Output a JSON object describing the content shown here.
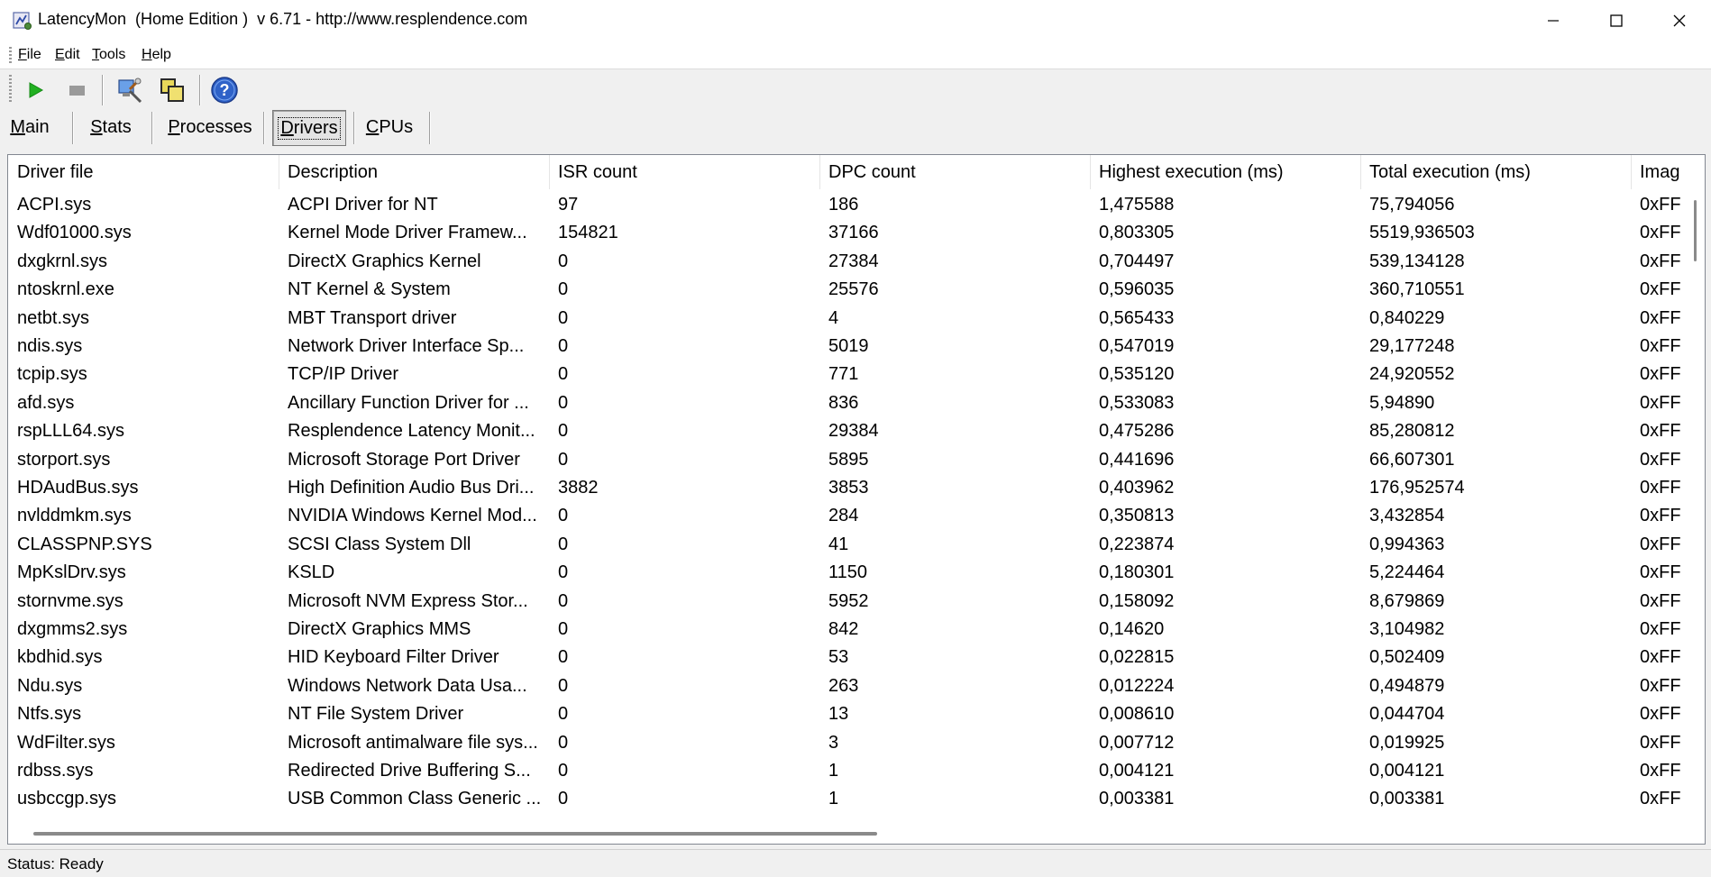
{
  "window": {
    "title": "LatencyMon  (Home Edition )  v 6.71 - http://www.resplendence.com",
    "controls": {
      "minimize": "minimize",
      "maximize": "maximize",
      "close": "close"
    }
  },
  "menu": [
    "File",
    "Edit",
    "Tools",
    "Help"
  ],
  "toolbar": {
    "buttons": [
      "play-icon",
      "stop-icon",
      "monitor-tools-icon",
      "windows-icon",
      "help-icon"
    ]
  },
  "tabs": [
    "Main",
    "Stats",
    "Processes",
    "Drivers",
    "CPUs"
  ],
  "active_tab": "Drivers",
  "table": {
    "columns": [
      "Driver file",
      "Description",
      "ISR count",
      "DPC count",
      "Highest execution (ms)",
      "Total execution (ms)",
      "Imag"
    ],
    "rows": [
      [
        "ACPI.sys",
        "ACPI Driver for NT",
        "97",
        "186",
        "1,475588",
        "75,794056",
        "0xFF"
      ],
      [
        "Wdf01000.sys",
        "Kernel Mode Driver Framew...",
        "154821",
        "37166",
        "0,803305",
        "5519,936503",
        "0xFF"
      ],
      [
        "dxgkrnl.sys",
        "DirectX Graphics Kernel",
        "0",
        "27384",
        "0,704497",
        "539,134128",
        "0xFF"
      ],
      [
        "ntoskrnl.exe",
        "NT Kernel & System",
        "0",
        "25576",
        "0,596035",
        "360,710551",
        "0xFF"
      ],
      [
        "netbt.sys",
        "MBT Transport driver",
        "0",
        "4",
        "0,565433",
        "0,840229",
        "0xFF"
      ],
      [
        "ndis.sys",
        "Network Driver Interface Sp...",
        "0",
        "5019",
        "0,547019",
        "29,177248",
        "0xFF"
      ],
      [
        "tcpip.sys",
        "TCP/IP Driver",
        "0",
        "771",
        "0,535120",
        "24,920552",
        "0xFF"
      ],
      [
        "afd.sys",
        "Ancillary Function Driver for ...",
        "0",
        "836",
        "0,533083",
        "5,94890",
        "0xFF"
      ],
      [
        "rspLLL64.sys",
        "Resplendence Latency Monit...",
        "0",
        "29384",
        "0,475286",
        "85,280812",
        "0xFF"
      ],
      [
        "storport.sys",
        "Microsoft Storage Port Driver",
        "0",
        "5895",
        "0,441696",
        "66,607301",
        "0xFF"
      ],
      [
        "HDAudBus.sys",
        "High Definition Audio Bus Dri...",
        "3882",
        "3853",
        "0,403962",
        "176,952574",
        "0xFF"
      ],
      [
        "nvlddmkm.sys",
        "NVIDIA Windows Kernel Mod...",
        "0",
        "284",
        "0,350813",
        "3,432854",
        "0xFF"
      ],
      [
        "CLASSPNP.SYS",
        "SCSI Class System Dll",
        "0",
        "41",
        "0,223874",
        "0,994363",
        "0xFF"
      ],
      [
        "MpKslDrv.sys",
        "KSLD",
        "0",
        "1150",
        "0,180301",
        "5,224464",
        "0xFF"
      ],
      [
        "stornvme.sys",
        "Microsoft NVM Express Stor...",
        "0",
        "5952",
        "0,158092",
        "8,679869",
        "0xFF"
      ],
      [
        "dxgmms2.sys",
        "DirectX Graphics MMS",
        "0",
        "842",
        "0,14620",
        "3,104982",
        "0xFF"
      ],
      [
        "kbdhid.sys",
        "HID Keyboard Filter Driver",
        "0",
        "53",
        "0,022815",
        "0,502409",
        "0xFF"
      ],
      [
        "Ndu.sys",
        "Windows Network Data Usa...",
        "0",
        "263",
        "0,012224",
        "0,494879",
        "0xFF"
      ],
      [
        "Ntfs.sys",
        "NT File System Driver",
        "0",
        "13",
        "0,008610",
        "0,044704",
        "0xFF"
      ],
      [
        "WdFilter.sys",
        "Microsoft antimalware file sys...",
        "0",
        "3",
        "0,007712",
        "0,019925",
        "0xFF"
      ],
      [
        "rdbss.sys",
        "Redirected Drive Buffering S...",
        "0",
        "1",
        "0,004121",
        "0,004121",
        "0xFF"
      ],
      [
        "usbccgp.sys",
        "USB Common Class Generic ...",
        "0",
        "1",
        "0,003381",
        "0,003381",
        "0xFF"
      ]
    ]
  },
  "status": "Status: Ready"
}
